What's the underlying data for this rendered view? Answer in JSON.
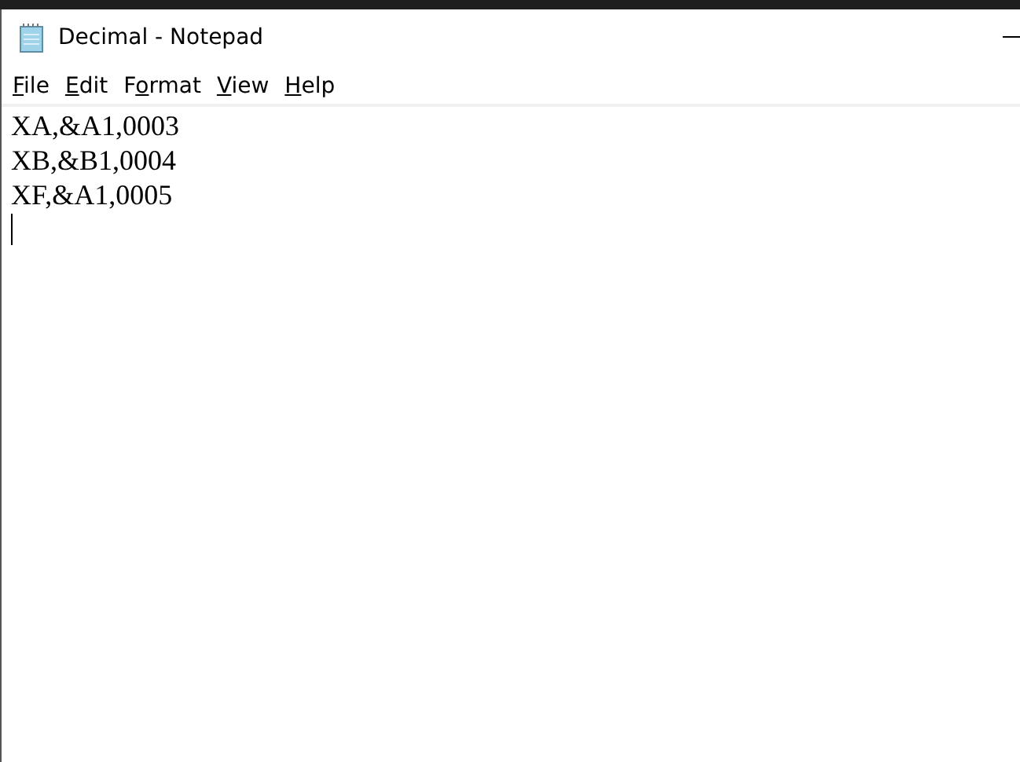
{
  "window": {
    "title": "Decimal - Notepad"
  },
  "menu": [
    {
      "key": "F",
      "after": "ile"
    },
    {
      "key": "E",
      "after": "dit"
    },
    {
      "before": "F",
      "key": "o",
      "after": "rmat"
    },
    {
      "key": "V",
      "after": "iew"
    },
    {
      "key": "H",
      "after": "elp"
    }
  ],
  "editor": {
    "lines": [
      "XA,&A1,0003",
      "XB,&B1,0004",
      "XF,&A1,0005"
    ]
  }
}
